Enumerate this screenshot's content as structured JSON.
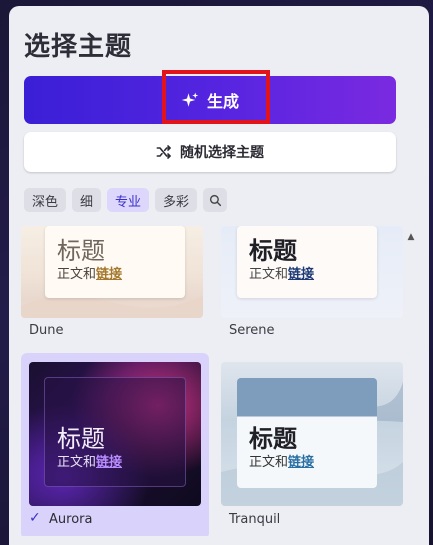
{
  "dialog": {
    "title": "选择主题",
    "generate_label": "生成",
    "random_label": "随机选择主题"
  },
  "filters": [
    "深色",
    "细",
    "专业",
    "多彩"
  ],
  "active_filter": "专业",
  "themes": [
    {
      "name": "Dune",
      "heading": "标题",
      "body": "正文和",
      "link": "链接",
      "selected": false
    },
    {
      "name": "Serene",
      "heading": "标题",
      "body": "正文和",
      "link": "链接",
      "selected": false
    },
    {
      "name": "Aurora",
      "heading": "标题",
      "body": "正文和",
      "link": "链接",
      "selected": true
    },
    {
      "name": "Tranquil",
      "heading": "标题",
      "body": "正文和",
      "link": "链接",
      "selected": false
    }
  ],
  "icons": {
    "generate": "sparkle-icon",
    "random": "shuffle-icon",
    "search": "search-icon",
    "check": "check-icon",
    "scroll": "scroll-up-arrow-icon"
  },
  "colors": {
    "accent": "#5424e0",
    "highlight": "#e0141a",
    "aurora_link": "#b98cff"
  }
}
